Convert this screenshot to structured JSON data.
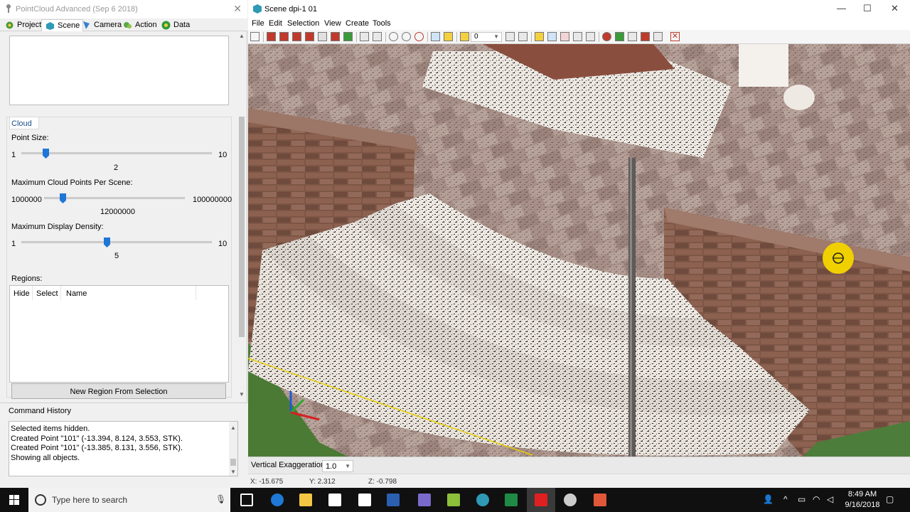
{
  "left_window": {
    "title": "PointCloud Advanced (Sep  6 2018)",
    "tabs": [
      {
        "label": "Project",
        "icon": "project-icon",
        "active": false
      },
      {
        "label": "Scene",
        "icon": "scene-icon",
        "active": true
      },
      {
        "label": "Camera",
        "icon": "camera-icon",
        "active": false
      },
      {
        "label": "Action",
        "icon": "action-icon",
        "active": false
      },
      {
        "label": "Data",
        "icon": "data-icon",
        "active": false
      }
    ],
    "cloud": {
      "group_label": "Cloud",
      "point_size": {
        "label": "Point Size:",
        "min": "1",
        "max": "10",
        "value": "2",
        "fraction": 0.11
      },
      "max_points": {
        "label": "Maximum Cloud Points Per Scene:",
        "min": "1000000",
        "max": "100000000",
        "value": "12000000",
        "fraction": 0.11
      },
      "max_density": {
        "label": "Maximum Display Density:",
        "min": "1",
        "max": "10",
        "value": "5",
        "fraction": 0.44
      }
    },
    "regions": {
      "label": "Regions:",
      "columns": [
        "Hide",
        "Select",
        "Name"
      ],
      "button": "New Region From Selection"
    },
    "command_history": {
      "label": "Command History",
      "lines": [
        "Selected items hidden.",
        "Created Point \"101\" (-13.394, 8.124, 3.553, STK).",
        "Created Point \"101\" (-13.385, 8.131, 3.556, STK).",
        "Showing all objects."
      ]
    }
  },
  "right_window": {
    "title": "Scene dpi-1 01",
    "menu": [
      "File",
      "Edit",
      "Selection",
      "View",
      "Create",
      "Tools"
    ],
    "toolbar_combo": "0",
    "vertical_exaggeration": {
      "label": "Vertical Exaggeration",
      "value": "1.0"
    },
    "status": {
      "x": "X: -15.675",
      "y": "Y: 2.312",
      "z": "Z: -0.798"
    }
  },
  "taskbar": {
    "search_placeholder": "Type here to search",
    "time": "8:49 AM",
    "date": "9/16/2018"
  },
  "colors": {
    "accent": "#1e76d6",
    "taskbar": "#101010",
    "brick": "#8a5a48",
    "step": "#e8e2dc"
  }
}
